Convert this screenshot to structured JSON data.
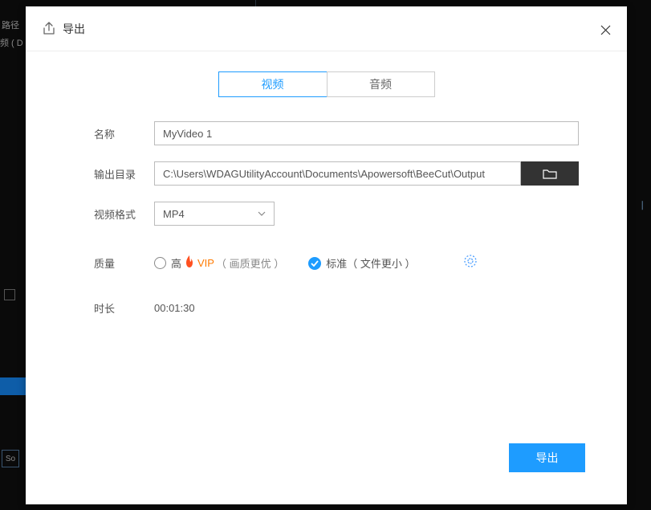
{
  "bg": {
    "t1": "路径",
    "t2": "频 ( D"
  },
  "header": {
    "title": "导出"
  },
  "tabs": {
    "video": "视频",
    "audio": "音频"
  },
  "labels": {
    "name": "名称",
    "outdir": "输出目录",
    "format": "视频格式",
    "quality": "质量",
    "duration": "时长"
  },
  "values": {
    "name": "MyVideo 1",
    "outdir": "C:\\Users\\WDAGUtilityAccount\\Documents\\Apowersoft\\BeeCut\\Output",
    "format": "MP4",
    "duration": "00:01:30"
  },
  "quality": {
    "high": "高",
    "vip": "VIP",
    "high_note": "（ 画质更优 ）",
    "standard": "标准（ 文件更小 ）"
  },
  "buttons": {
    "export": "导出"
  },
  "so": "So"
}
